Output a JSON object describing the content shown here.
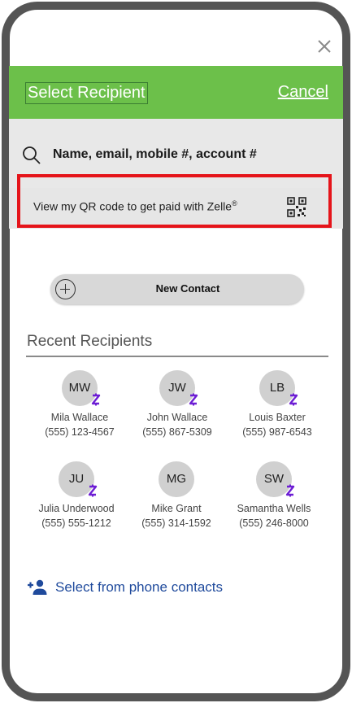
{
  "header": {
    "title": "Select Recipient",
    "cancel_label": "Cancel",
    "close_icon": "close-icon"
  },
  "search": {
    "placeholder": "Name, email, mobile #, account #",
    "icon": "search-icon"
  },
  "qr": {
    "text": "View my QR code to get paid with Zelle",
    "trademark": "®",
    "icon": "qr-code-icon",
    "highlight_color": "#e5141a"
  },
  "new_contact": {
    "label": "New Contact",
    "icon": "plus-circle-icon"
  },
  "recent": {
    "title": "Recent Recipients",
    "items": [
      {
        "initials": "MW",
        "name": "Mila Wallace",
        "phone": "(555) 123-4567"
      },
      {
        "initials": "JW",
        "name": "John Wallace",
        "phone": "(555) 867-5309"
      },
      {
        "initials": "LB",
        "name": "Louis Baxter",
        "phone": "(555) 987-6543"
      },
      {
        "initials": "JU",
        "name": "Julia Underwood",
        "phone": "(555) 555-1212"
      },
      {
        "initials": "MG",
        "name": "Mike Grant",
        "phone": "(555) 314-1592"
      },
      {
        "initials": "SW",
        "name": "Samantha Wells",
        "phone": "(555) 246-8000"
      }
    ]
  },
  "phone_contacts": {
    "label": "Select from phone contacts",
    "icon": "add-person-icon"
  },
  "colors": {
    "header_green": "#6cc04a",
    "zelle_purple": "#6d1ed4",
    "link_blue": "#1f4a9c",
    "frame": "#555555"
  }
}
